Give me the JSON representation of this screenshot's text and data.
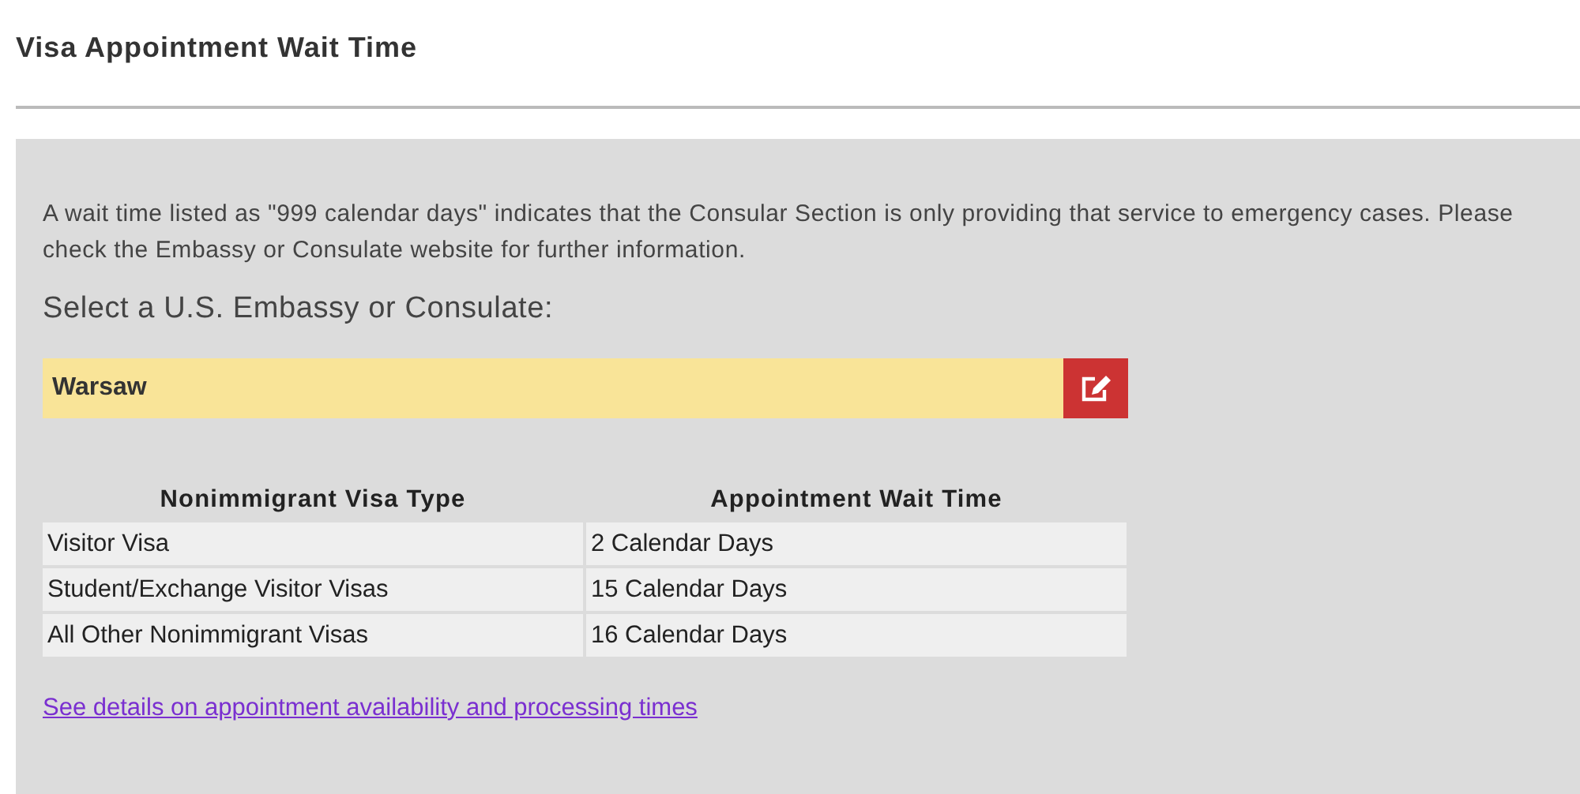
{
  "page_title": "Visa Appointment Wait Time",
  "notice": "A wait time listed as \"999 calendar days\" indicates that the Consular Section is only providing that service to emergency cases.  Please check the Embassy or Consulate website for further information.",
  "select_label": "Select a U.S. Embassy or Consulate:",
  "location_field": {
    "value": "Warsaw"
  },
  "table": {
    "columns": [
      "Nonimmigrant Visa Type",
      "Appointment Wait Time"
    ],
    "rows": [
      [
        "Visitor Visa",
        "2 Calendar Days"
      ],
      [
        "Student/Exchange Visitor Visas",
        "15 Calendar Days"
      ],
      [
        "All Other Nonimmigrant Visas",
        "16 Calendar Days"
      ]
    ]
  },
  "details_link": "See details on appointment availability and processing times"
}
